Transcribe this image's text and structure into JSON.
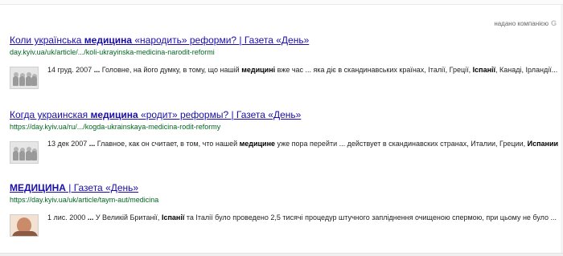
{
  "branding": {
    "label": "надано компанією",
    "logo_letter": "G"
  },
  "results": [
    {
      "title": [
        {
          "t": "Коли українська ",
          "b": false
        },
        {
          "t": "медицина",
          "b": true
        },
        {
          "t": " «народить» реформи? | Газета «День»",
          "b": false
        }
      ],
      "url": "day.kyiv.ua/uk/article/.../koli-ukrayinska-medicina-narodit-reformi",
      "thumbnail": "newspaper-photo",
      "snippet": [
        {
          "t": "14 груд. 2007 ",
          "b": false
        },
        {
          "t": "...",
          "b": true
        },
        {
          "t": " Головне, на його думку, в тому, що нашій ",
          "b": false
        },
        {
          "t": "медицині",
          "b": true
        },
        {
          "t": " вже час ... яка діє в скандинавських країнах, Італії, Греції, ",
          "b": false
        },
        {
          "t": "Іспанії",
          "b": true
        },
        {
          "t": ", Канаді, Ірландії... ",
          "b": false
        },
        {
          "t": "+.",
          "b": true
        }
      ]
    },
    {
      "title": [
        {
          "t": "Когда украинская ",
          "b": false
        },
        {
          "t": "медицина",
          "b": true
        },
        {
          "t": " «родит» реформы? | Газета «День»",
          "b": false
        }
      ],
      "url": "https://day.kyiv.ua/ru/.../kogda-ukrainskaya-medicina-rodit-reformy",
      "thumbnail": "newspaper-photo",
      "snippet": [
        {
          "t": "13 дек 2007 ",
          "b": false
        },
        {
          "t": "...",
          "b": true
        },
        {
          "t": " Главное, как он считает, в том, что нашей ",
          "b": false
        },
        {
          "t": "медицине",
          "b": true
        },
        {
          "t": " уже пора перейти ... действует в скандинавских странах, Италии, Греции, ",
          "b": false
        },
        {
          "t": "Испании",
          "b": true
        },
        {
          "t": ", ...",
          "b": false
        }
      ]
    },
    {
      "title": [
        {
          "t": "МЕДИЦИНА",
          "b": true
        },
        {
          "t": " | Газета «День»",
          "b": false
        }
      ],
      "url": "https://day.kyiv.ua/uk/article/taym-aut/medicina",
      "thumbnail": "person-photo",
      "snippet": [
        {
          "t": "1 лис. 2000 ",
          "b": false
        },
        {
          "t": "...",
          "b": true
        },
        {
          "t": " У Великій Британії, ",
          "b": false
        },
        {
          "t": "Іспанії",
          "b": true
        },
        {
          "t": " та Італії було проведено 2,5 тисячі процедур штучного запліднення очищеною спермою, при цьому не було ...",
          "b": false
        }
      ]
    }
  ]
}
